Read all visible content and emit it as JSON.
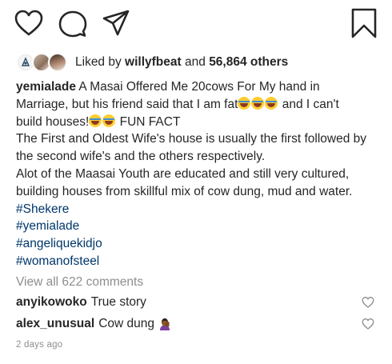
{
  "actions": {
    "like_icon": "heart-outline-icon",
    "comment_icon": "comment-bubble-icon",
    "share_icon": "paper-plane-icon",
    "save_icon": "bookmark-icon"
  },
  "likes": {
    "prefix": "Liked by",
    "user": "willyfbeat",
    "joiner": "and",
    "count": "56,864 others"
  },
  "caption": {
    "username": "yemialade",
    "line1": "A Masai Offered Me 20cows For My hand in",
    "line2a": "Marriage, but his friend said that I am fat",
    "line2b": " and I can't",
    "line3a": "build houses!",
    "line3b": " FUN FACT",
    "line4": "The First and Oldest Wife's house is usually the first followed by",
    "line5": "the second wife's and the others respectively.",
    "line6": "Alot of the Maasai Youth are educated and still very cultured,",
    "line7": "building houses from skillful mix of cow dung, mud and water.",
    "hashtags": [
      "#Shekere",
      "#yemialade",
      "#angeliquekidjo",
      "#womanofsteel"
    ]
  },
  "view_all": "View all 622 comments",
  "comments": [
    {
      "user": "anyikowoko",
      "text": "True story"
    },
    {
      "user": "alex_unusual",
      "text": "Cow dung"
    }
  ],
  "timestamp": "2 days ago",
  "colors": {
    "text": "#262626",
    "muted": "#8e8e8e",
    "hashtag": "#00376b"
  }
}
